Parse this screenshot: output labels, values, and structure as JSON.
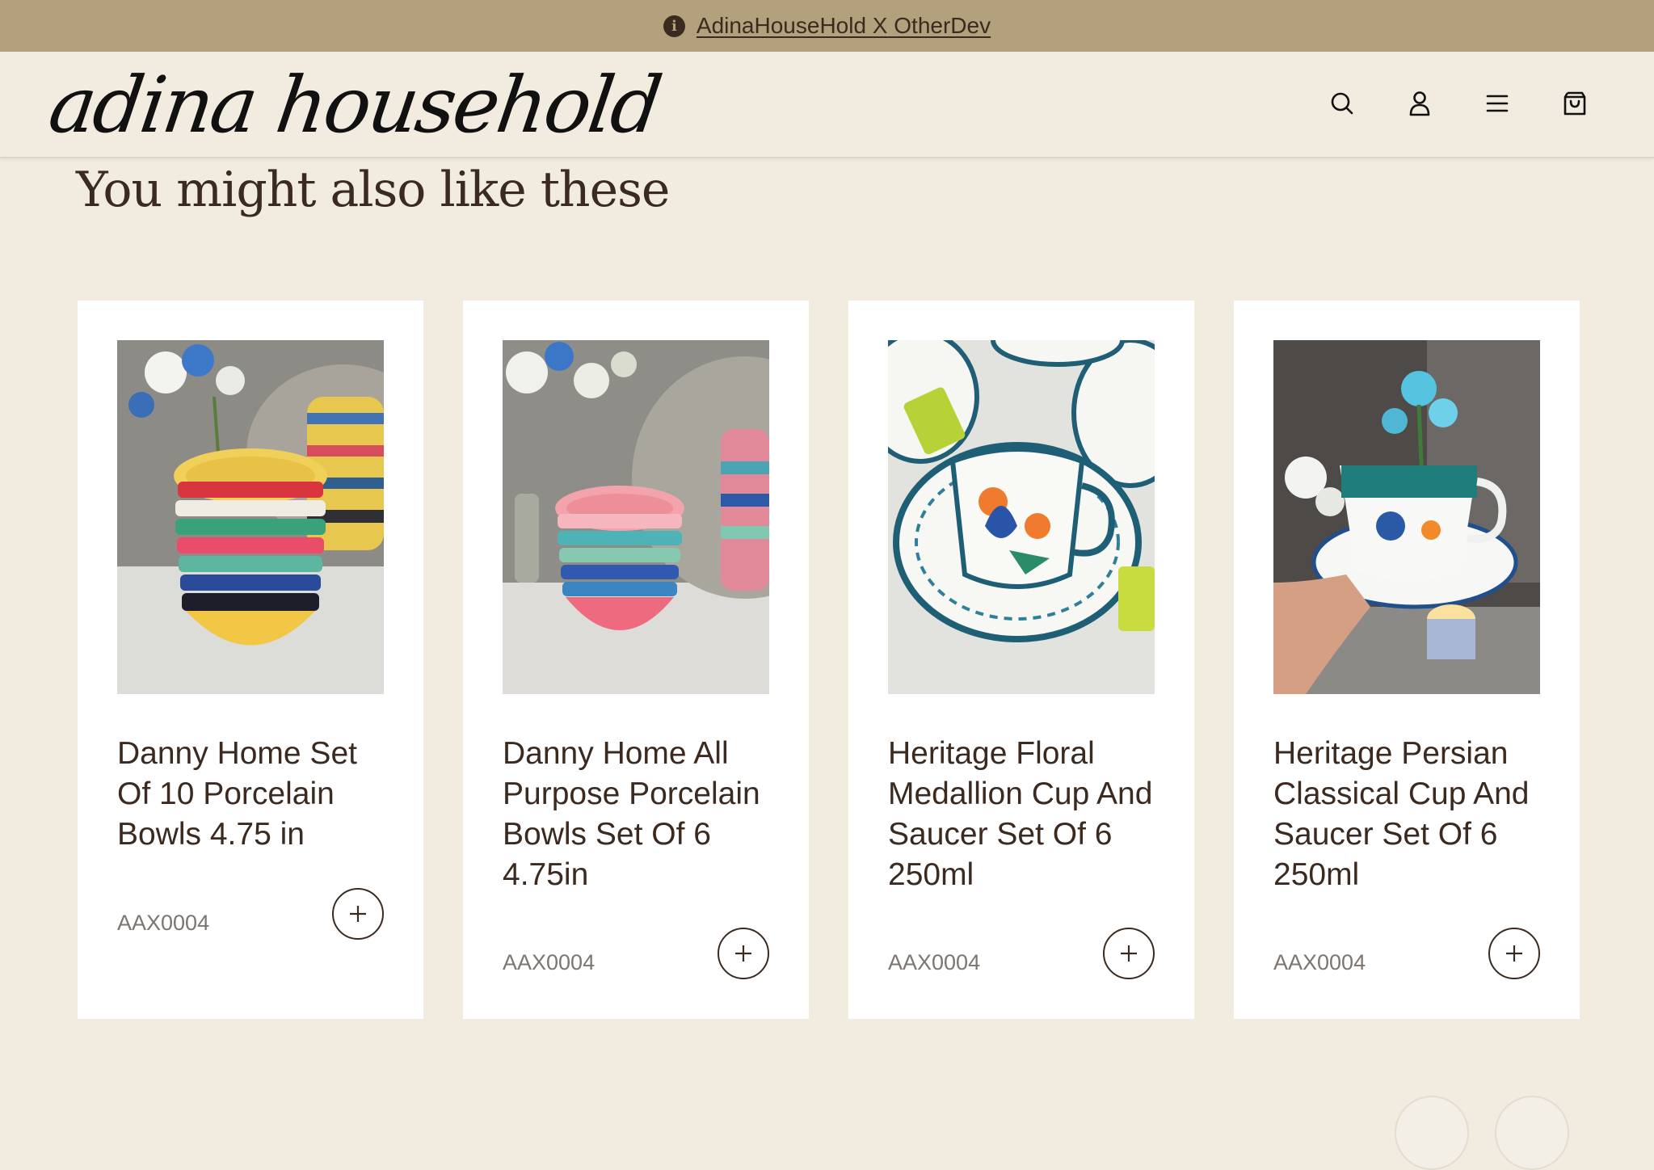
{
  "announcement": {
    "icon": "info-icon",
    "link_text": "AdinaHouseHold X OtherDev"
  },
  "header": {
    "logo_text": "adina household",
    "icons": [
      "search-icon",
      "account-icon",
      "menu-icon",
      "cart-icon"
    ]
  },
  "section": {
    "title": "You might also like these"
  },
  "products": [
    {
      "title": "Danny Home Set Of 10 Porcelain Bowls 4.75 in",
      "sku": "AAX0004",
      "add_label": "+"
    },
    {
      "title": "Danny Home All Purpose Porcelain Bowls Set Of 6 4.75in",
      "sku": "AAX0004",
      "add_label": "+"
    },
    {
      "title": "Heritage Floral Medallion Cup And Saucer Set Of 6 250ml",
      "sku": "AAX0004",
      "add_label": "+"
    },
    {
      "title": "Heritage Persian Classical Cup And Saucer Set Of 6 250ml",
      "sku": "AAX0004",
      "add_label": "+"
    }
  ],
  "colors": {
    "announcement_bg": "#b2a17c",
    "page_bg": "#f1ebe0",
    "text": "#3a2a20",
    "sku_text": "#7d7570"
  }
}
